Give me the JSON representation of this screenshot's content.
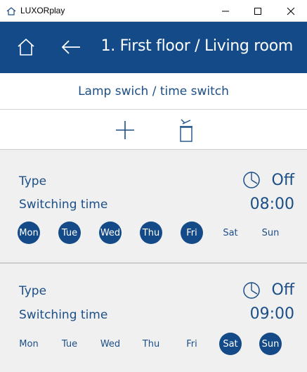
{
  "window": {
    "title": "LUXORplay",
    "minimize_glyph": "—",
    "maximize_glyph": "☐",
    "close_glyph": "✕"
  },
  "header": {
    "title": "1. First floor / Living room",
    "home_icon": "home-icon",
    "back_icon": "back-arrow-icon"
  },
  "subtitle": "Lamp swich / time switch",
  "toolbar": {
    "add_icon": "plus-icon",
    "delete_icon": "trash-icon"
  },
  "entries": [
    {
      "type_label": "Type",
      "type_value": "Off",
      "switching_label": "Switching time",
      "switching_value": "08:00",
      "days": [
        {
          "label": "Mon",
          "active": true
        },
        {
          "label": "Tue",
          "active": true
        },
        {
          "label": "Wed",
          "active": true
        },
        {
          "label": "Thu",
          "active": true
        },
        {
          "label": "Fri",
          "active": true
        },
        {
          "label": "Sat",
          "active": false
        },
        {
          "label": "Sun",
          "active": false
        }
      ]
    },
    {
      "type_label": "Type",
      "type_value": "Off",
      "switching_label": "Switching time",
      "switching_value": "09:00",
      "days": [
        {
          "label": "Mon",
          "active": false
        },
        {
          "label": "Tue",
          "active": false
        },
        {
          "label": "Wed",
          "active": false
        },
        {
          "label": "Thu",
          "active": false
        },
        {
          "label": "Fri",
          "active": false
        },
        {
          "label": "Sat",
          "active": true
        },
        {
          "label": "Sun",
          "active": true
        }
      ]
    }
  ],
  "colors": {
    "accent": "#134a87",
    "text": "#1c4f86",
    "background": "#f0f0f0"
  }
}
